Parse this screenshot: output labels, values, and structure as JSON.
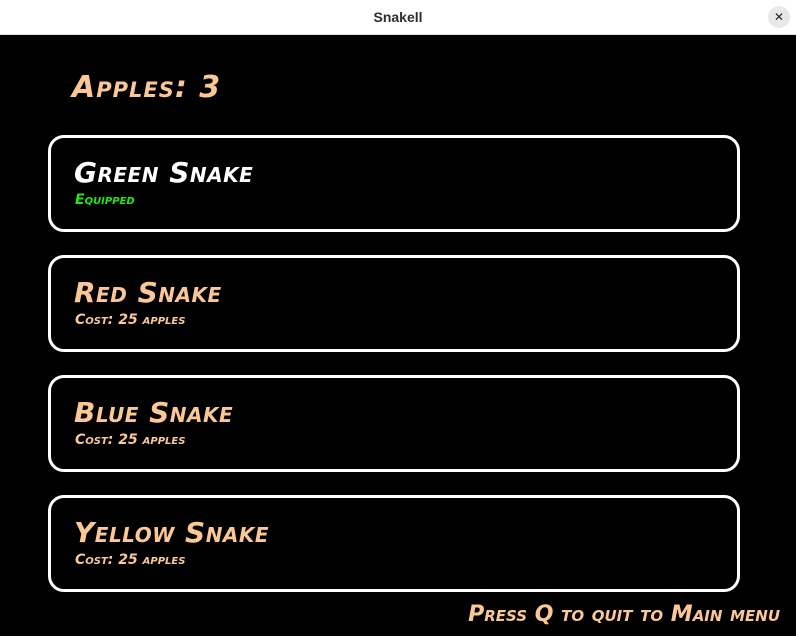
{
  "window": {
    "title": "Snakell",
    "close_glyph": "✕"
  },
  "header": {
    "apples_label": "Apples: 3"
  },
  "shop": {
    "items": [
      {
        "name": "Green Snake",
        "status": "Equipped",
        "equipped": true
      },
      {
        "name": "Red Snake",
        "status": "Cost: 25 apples",
        "equipped": false
      },
      {
        "name": "Blue Snake",
        "status": "Cost: 25 apples",
        "equipped": false
      },
      {
        "name": "Yellow Snake",
        "status": "Cost: 25 apples",
        "equipped": false
      }
    ]
  },
  "footer": {
    "hint": "Press Q to quit to Main menu"
  },
  "colors": {
    "background": "#000000",
    "text_accent": "#fcc797",
    "equipped_text": "#22e61a",
    "selected_name": "#ffffff",
    "card_border": "#ffffff"
  }
}
